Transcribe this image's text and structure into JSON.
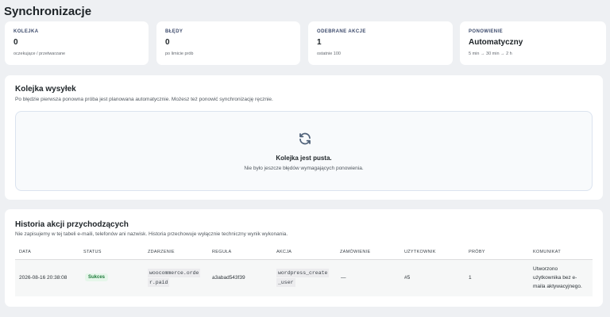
{
  "page": {
    "title": "Synchronizacje"
  },
  "stats": [
    {
      "label": "KOLEJKA",
      "value": "0",
      "sub": "oczekujące / przetwarzane"
    },
    {
      "label": "BŁĘDY",
      "value": "0",
      "sub": "po limicie prób"
    },
    {
      "label": "ODEBRANE AKCJE",
      "value": "1",
      "sub": "ostatnie 100"
    },
    {
      "label": "PONOWIENIE",
      "value": "Automatyczny",
      "sub": "5 min → 30 min → 2 h"
    }
  ],
  "queue": {
    "title": "Kolejka wysyłek",
    "description": "Po błędzie pierwsza ponowna próba jest planowana automatycznie. Możesz też ponowić synchronizację ręcznie.",
    "empty_icon": "refresh-icon",
    "empty_title": "Kolejka jest pusta.",
    "empty_subtitle": "Nie było jeszcze błędów wymagających ponowienia."
  },
  "history": {
    "title": "Historia akcji przychodzących",
    "description": "Nie zapisujemy w tej tabeli e-maili, telefonów ani nazwisk. Historia przechowuje wyłącznie techniczny wynik wykonania.",
    "columns": [
      "DATA",
      "STATUS",
      "ZDARZENIE",
      "REGUŁA",
      "AKCJA",
      "ZAMÓWIENIE",
      "UŻYTKOWNIK",
      "PRÓBY",
      "KOMUNIKAT"
    ],
    "rows": [
      {
        "date": "2026-08-16 20:38:08",
        "status": "Sukces",
        "event_line1": "woocommerce.orde",
        "event_line2": "r.paid",
        "rule": "a3abad543f39",
        "action_line1": "wordpress_create",
        "action_line2": "_user",
        "order": "—",
        "user": "#5",
        "attempts": "1",
        "message_line1": "Utworzono",
        "message_line2": "użytkownika bez e-",
        "message_line3": "maila aktywacyjnego."
      }
    ]
  },
  "colors": {
    "success_bg": "#e6f6ea",
    "success_text": "#1e7a3a",
    "accent_icon": "#50627a"
  }
}
